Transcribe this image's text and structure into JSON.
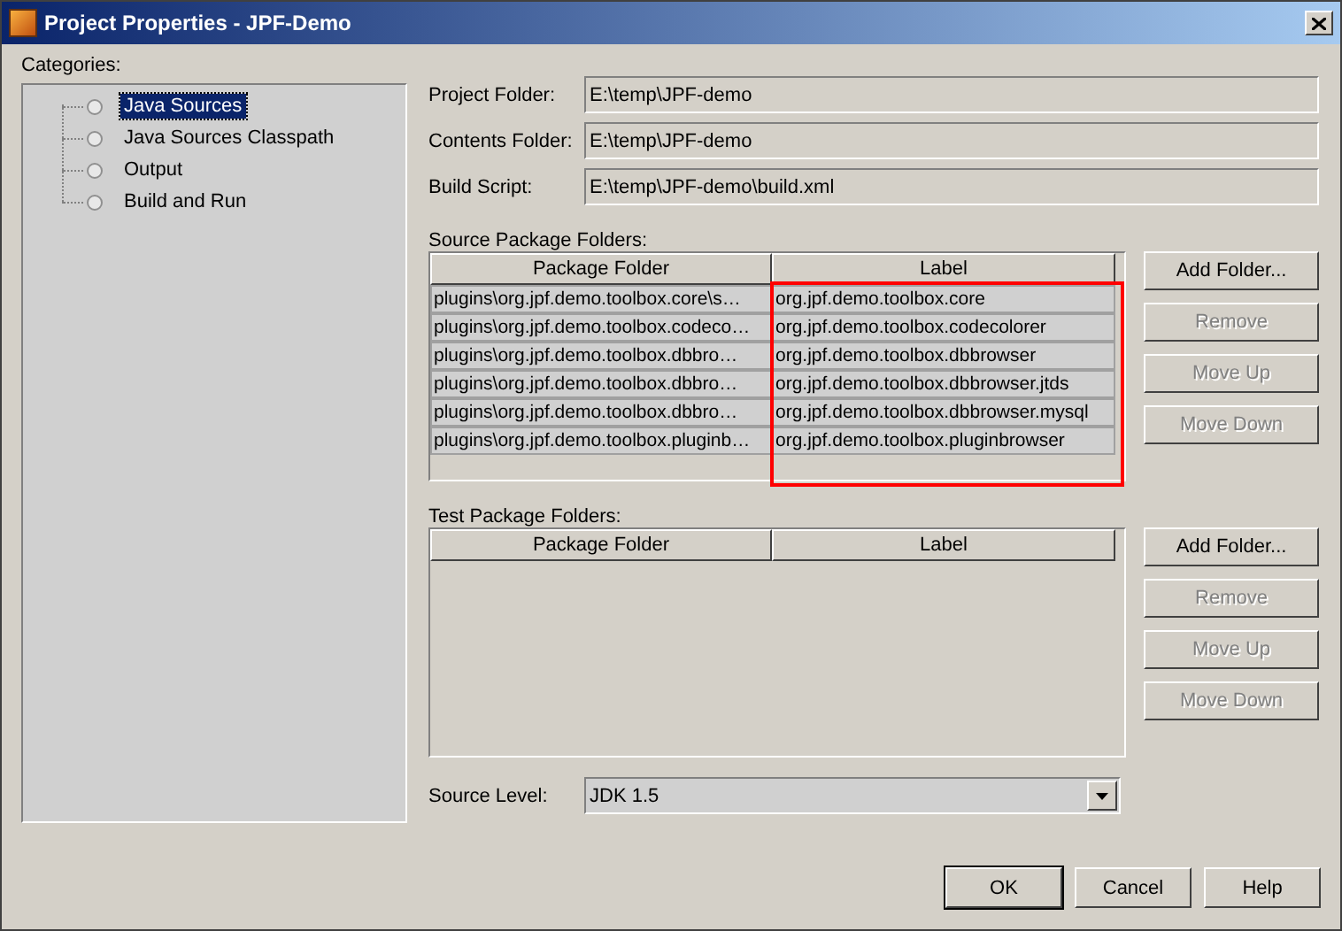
{
  "window": {
    "title": "Project Properties - JPF-Demo"
  },
  "categories": {
    "label": "Categories:",
    "items": [
      {
        "label": "Java Sources",
        "selected": true
      },
      {
        "label": "Java Sources Classpath",
        "selected": false
      },
      {
        "label": "Output",
        "selected": false
      },
      {
        "label": "Build and Run",
        "selected": false
      }
    ]
  },
  "fields": [
    {
      "label": "Project Folder:",
      "value": "E:\\temp\\JPF-demo"
    },
    {
      "label": "Contents Folder:",
      "value": "E:\\temp\\JPF-demo"
    },
    {
      "label": "Build Script:",
      "value": "E:\\temp\\JPF-demo\\build.xml"
    }
  ],
  "source_package_folders": {
    "label": "Source Package Folders:",
    "columns": [
      {
        "label": "Package Folder",
        "highlighted": false
      },
      {
        "label": "Label",
        "highlighted": true
      }
    ],
    "rows": [
      [
        "plugins\\org.jpf.demo.toolbox.core\\s…",
        "org.jpf.demo.toolbox.core"
      ],
      [
        "plugins\\org.jpf.demo.toolbox.codeco…",
        "org.jpf.demo.toolbox.codecolorer"
      ],
      [
        "plugins\\org.jpf.demo.toolbox.dbbro…",
        "org.jpf.demo.toolbox.dbbrowser"
      ],
      [
        "plugins\\org.jpf.demo.toolbox.dbbro…",
        "org.jpf.demo.toolbox.dbbrowser.jtds"
      ],
      [
        "plugins\\org.jpf.demo.toolbox.dbbro…",
        "org.jpf.demo.toolbox.dbbrowser.mysql"
      ],
      [
        "plugins\\org.jpf.demo.toolbox.pluginb…",
        "org.jpf.demo.toolbox.pluginbrowser"
      ]
    ],
    "buttons": [
      {
        "label": "Add Folder...",
        "disabled": false
      },
      {
        "label": "Remove",
        "disabled": true
      },
      {
        "label": "Move Up",
        "disabled": true
      },
      {
        "label": "Move Down",
        "disabled": true
      }
    ]
  },
  "test_package_folders": {
    "label": "Test Package Folders:",
    "columns": [
      {
        "label": "Package Folder",
        "highlighted": false
      },
      {
        "label": "Label",
        "highlighted": false
      }
    ],
    "buttons": [
      {
        "label": "Add Folder...",
        "disabled": false
      },
      {
        "label": "Remove",
        "disabled": true
      },
      {
        "label": "Move Up",
        "disabled": true
      },
      {
        "label": "Move Down",
        "disabled": true
      }
    ]
  },
  "source_level": {
    "label": "Source Level:",
    "value": "JDK 1.5"
  },
  "buttons": [
    {
      "label": "OK",
      "default": true
    },
    {
      "label": "Cancel",
      "default": false
    },
    {
      "label": "Help",
      "default": false
    }
  ]
}
